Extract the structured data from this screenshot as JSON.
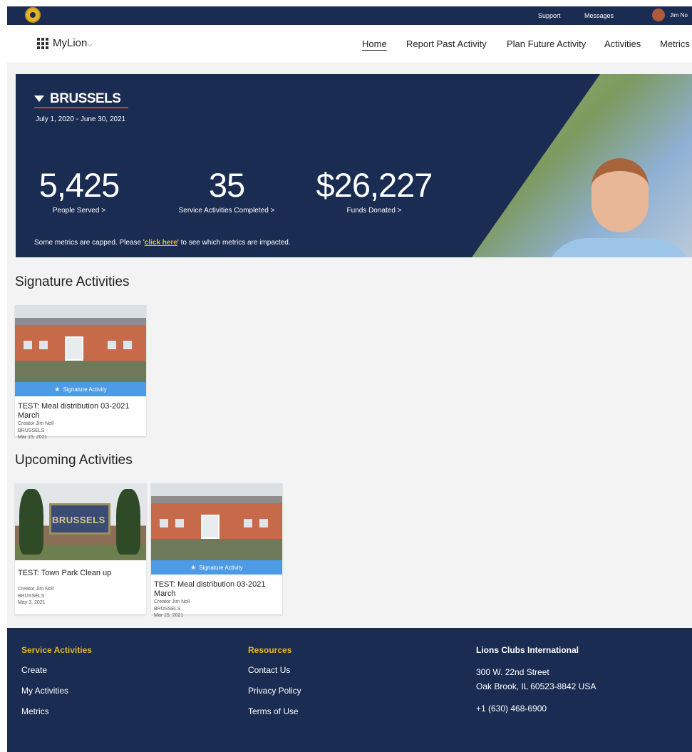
{
  "topbar": {
    "support": "Support",
    "messages": "Messages",
    "user": "Jim No"
  },
  "nav": {
    "brand": "MyLion",
    "brand_chevron": "⌵",
    "items": [
      "Home",
      "Report Past Activity",
      "Plan Future Activity",
      "Activities",
      "Metrics"
    ]
  },
  "hero": {
    "city": "BRUSSELS",
    "dates": "July 1, 2020 - June 30, 2021",
    "metrics": [
      {
        "value": "5,425",
        "label": "People Served >"
      },
      {
        "value": "35",
        "label": "Service Activities Completed >"
      },
      {
        "value": "$26,227",
        "label": "Funds Donated >"
      }
    ],
    "note_before": "Some metrics are capped. Please '",
    "note_link": "click here",
    "note_after": "' to see which metrics are impacted."
  },
  "signature": {
    "heading": "Signature Activities",
    "cards": [
      {
        "badge": "Signature Activity",
        "title": "TEST: Meal distribution 03-2021 March",
        "creator": "Creator Jim Noll",
        "club": "BRUSSELS",
        "date": "Mar 15, 2021"
      }
    ]
  },
  "upcoming": {
    "heading": "Upcoming Activities",
    "cards": [
      {
        "sign_text": "BRUSSELS",
        "title": "TEST: Town Park Clean up",
        "creator": "Creator Jim Noll",
        "club": "BRUSSELS",
        "date": "May 3, 2021"
      },
      {
        "badge": "Signature Activity",
        "title": "TEST: Meal distribution 03-2021 March",
        "creator": "Creator Jim Noll",
        "club": "BRUSSELS",
        "date": "Mar 15, 2021"
      }
    ]
  },
  "footer": {
    "service": {
      "heading": "Service Activities",
      "links": [
        "Create",
        "My Activities",
        "Metrics"
      ]
    },
    "resources": {
      "heading": "Resources",
      "links": [
        "Contact Us",
        "Privacy Policy",
        "Terms of Use"
      ]
    },
    "org": {
      "heading": "Lions Clubs International",
      "address1": "300 W. 22nd Street",
      "address2": "Oak Brook, IL 60523-8842 USA",
      "phone": "+1 (630) 468-6900"
    }
  },
  "colors": {
    "navy": "#1a2c52",
    "gold": "#e3b623",
    "badge_blue": "#4d9be6",
    "accent_red": "#d23b2a"
  }
}
